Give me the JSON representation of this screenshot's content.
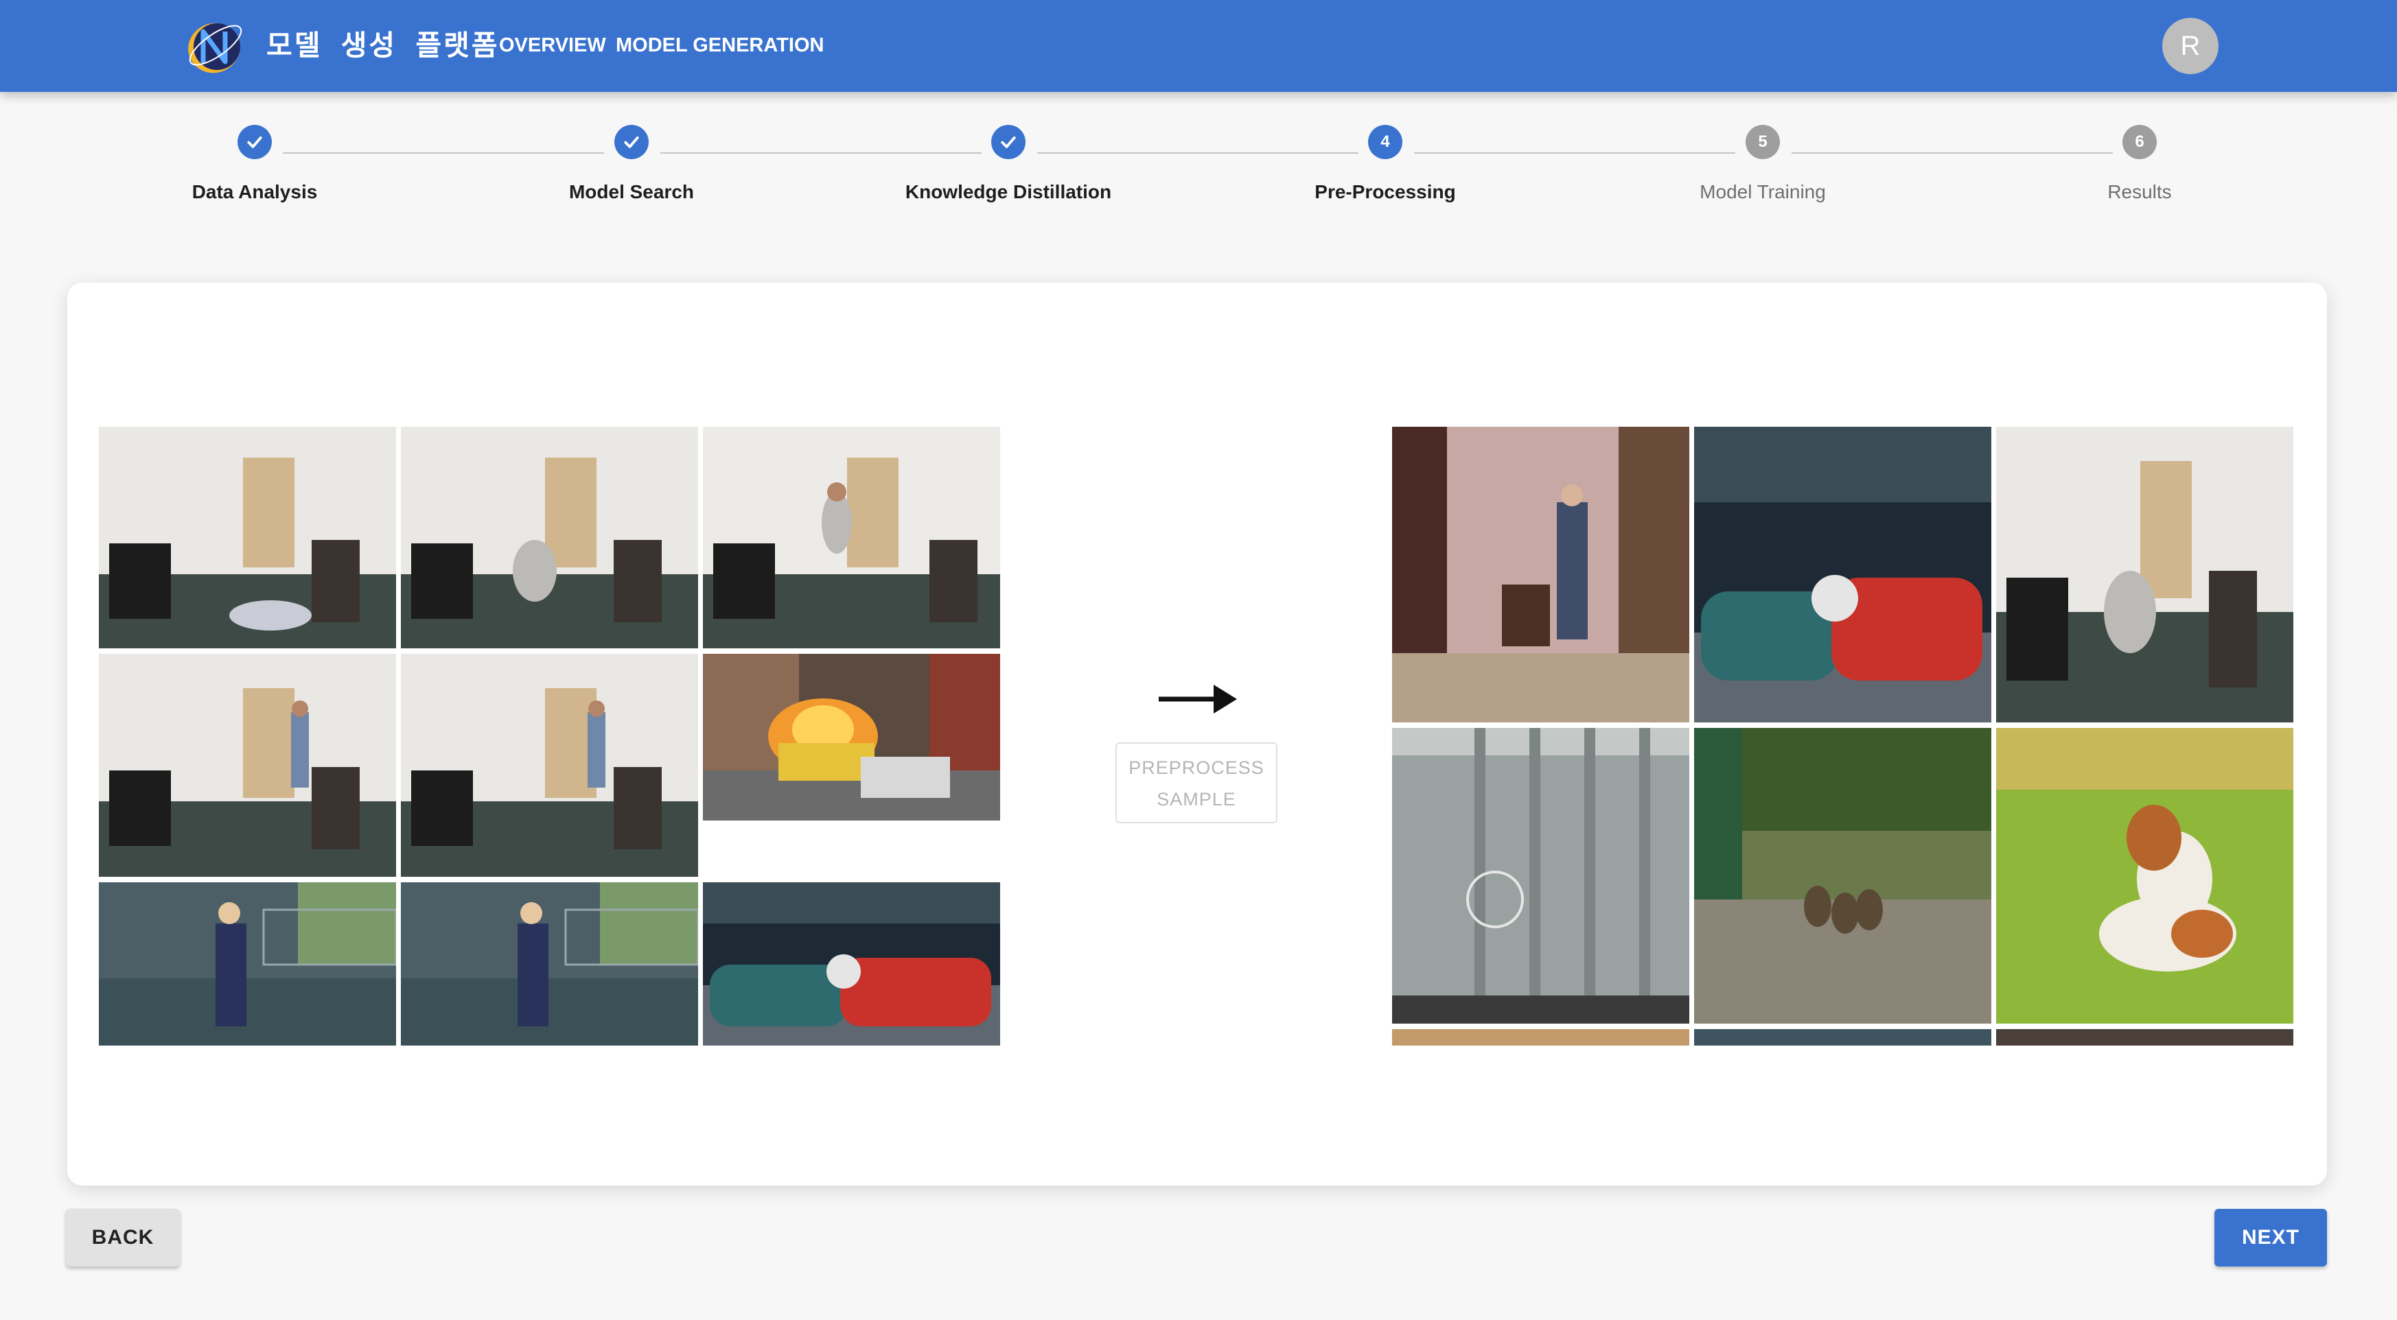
{
  "header": {
    "app_title": "모델 생성 플랫폼",
    "nav": [
      {
        "label": "OVERVIEW"
      },
      {
        "label": "MODEL GENERATION"
      }
    ],
    "avatar_initial": "R"
  },
  "stepper": {
    "steps": [
      {
        "index": "1",
        "label": "Data Analysis",
        "state": "done"
      },
      {
        "index": "2",
        "label": "Model Search",
        "state": "done"
      },
      {
        "index": "3",
        "label": "Knowledge Distillation",
        "state": "done"
      },
      {
        "index": "4",
        "label": "Pre-Processing",
        "state": "active"
      },
      {
        "index": "5",
        "label": "Model Training",
        "state": "pending"
      },
      {
        "index": "6",
        "label": "Results",
        "state": "pending"
      }
    ]
  },
  "preprocess": {
    "button_label": "PREPROCESS SAMPLE",
    "arrow_icon": "arrow-right-icon",
    "input_samples": [
      {
        "scene": "person-fallen-office"
      },
      {
        "scene": "person-falling-office"
      },
      {
        "scene": "person-jumping-office"
      },
      {
        "scene": "person-standing-office"
      },
      {
        "scene": "person-standing-office"
      },
      {
        "scene": "car-on-fire-street"
      },
      {
        "scene": "person-tennis-court"
      },
      {
        "scene": "person-tennis-court"
      },
      {
        "scene": "car-crash"
      }
    ],
    "output_samples": [
      {
        "scene": "person-standing-bedroom"
      },
      {
        "scene": "car-crash"
      },
      {
        "scene": "person-falling-office"
      },
      {
        "scene": "broken-window"
      },
      {
        "scene": "ducks-on-grass"
      },
      {
        "scene": "dog-barking-grass"
      },
      {
        "scene": "partial"
      },
      {
        "scene": "partial"
      },
      {
        "scene": "partial"
      }
    ]
  },
  "footer": {
    "back_label": "BACK",
    "next_label": "NEXT"
  },
  "colors": {
    "primary": "#3a73cf",
    "pending": "#9e9e9e",
    "background": "#f7f7f7"
  }
}
